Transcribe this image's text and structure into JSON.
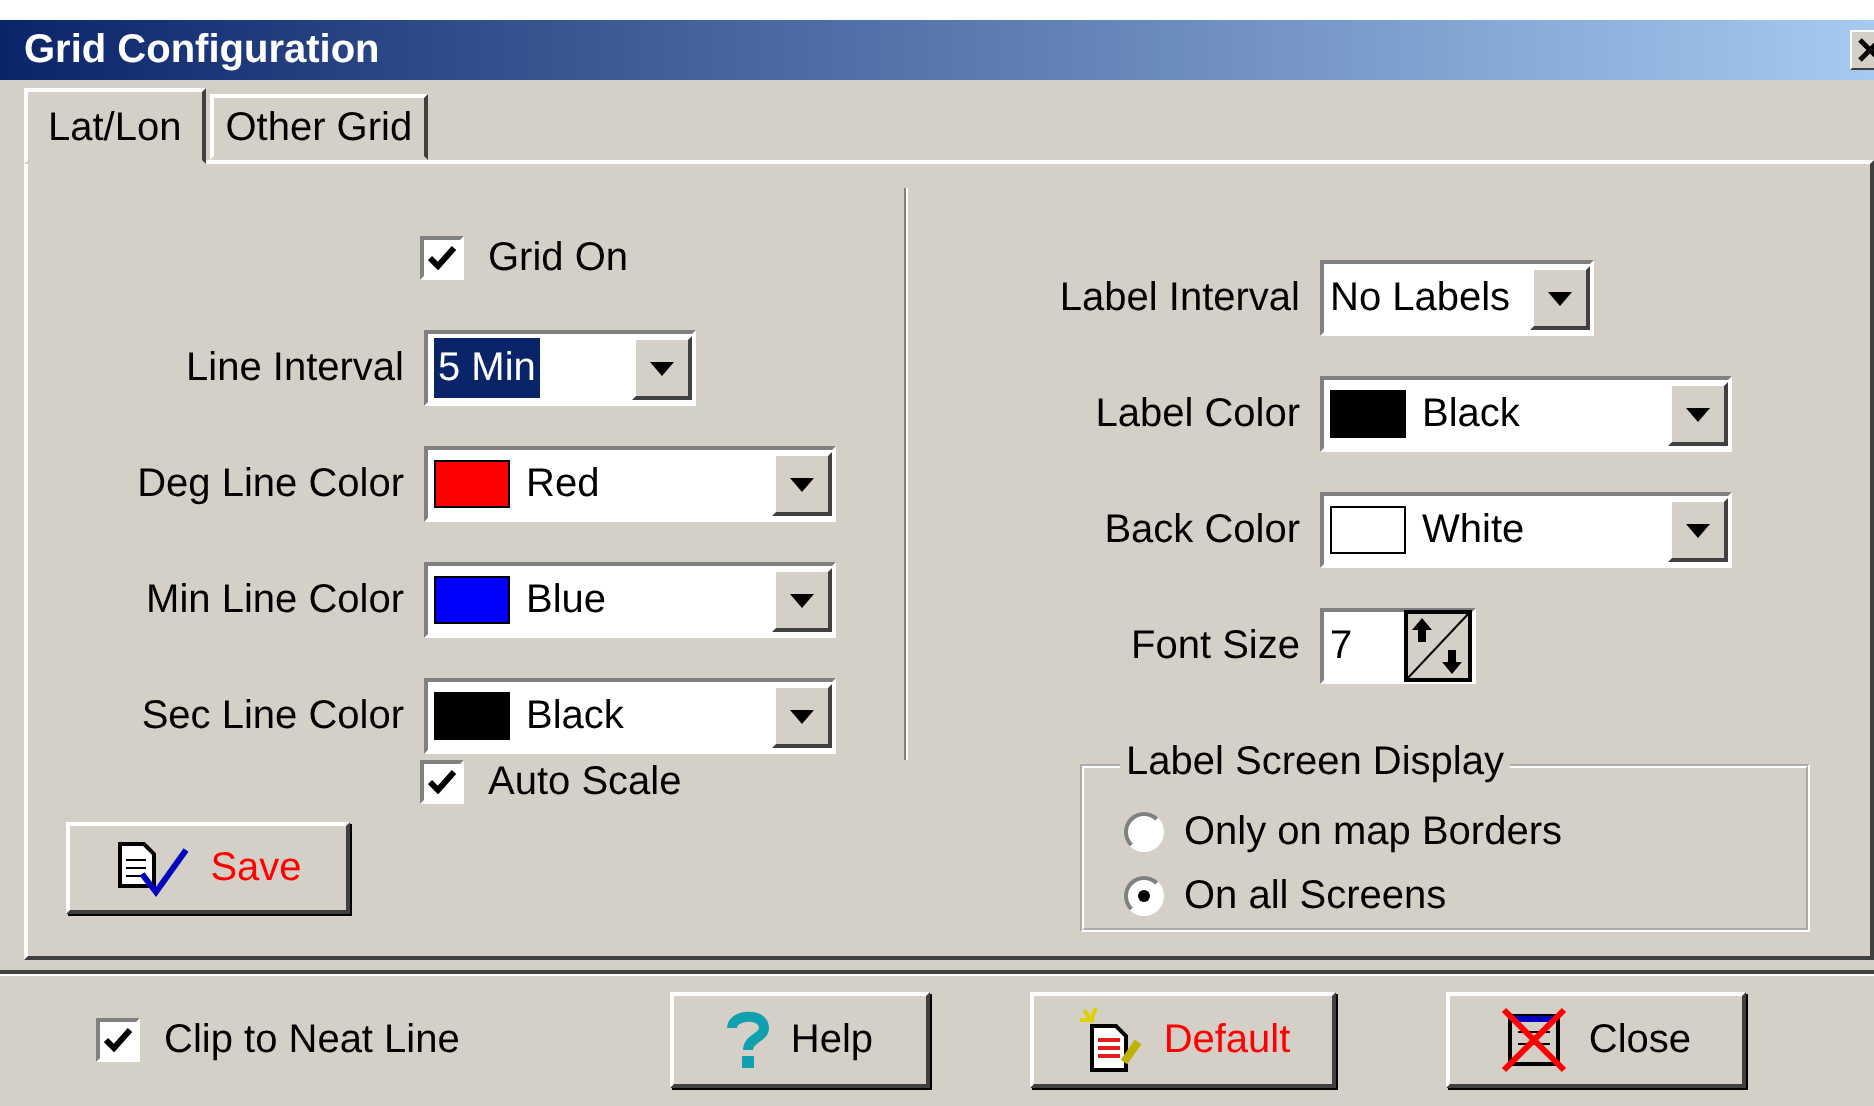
{
  "window": {
    "title": "Grid Configuration"
  },
  "tabs": [
    {
      "label": "Lat/Lon",
      "selected": true
    },
    {
      "label": "Other Grid",
      "selected": false
    }
  ],
  "grid_on": {
    "label": "Grid On",
    "checked": true
  },
  "left_fields": [
    {
      "label": "Line Interval",
      "value": "5 Min",
      "kind": "select",
      "highlighted": true
    },
    {
      "label": "Deg Line Color",
      "value": "Red",
      "kind": "color",
      "color": "#ff0000"
    },
    {
      "label": "Min Line Color",
      "value": "Blue",
      "kind": "color",
      "color": "#0000ff"
    },
    {
      "label": "Sec Line Color",
      "value": "Black",
      "kind": "color",
      "color": "#000000"
    }
  ],
  "auto_scale": {
    "label": "Auto Scale",
    "checked": true
  },
  "save_button": {
    "label": "Save"
  },
  "right_fields": [
    {
      "label": "Label Interval",
      "value": "No Labels",
      "kind": "select",
      "highlighted": false
    },
    {
      "label": "Label Color",
      "value": "Black",
      "kind": "color",
      "color": "#000000"
    },
    {
      "label": "Back Color",
      "value": "White",
      "kind": "color",
      "color": "#ffffff"
    },
    {
      "label": "Font Size",
      "value": "7",
      "kind": "spin"
    }
  ],
  "label_screen_display": {
    "title": "Label Screen Display",
    "options": [
      {
        "label": "Only on map Borders",
        "selected": false
      },
      {
        "label": "On all Screens",
        "selected": true
      }
    ]
  },
  "clip_to_neat_line": {
    "label": "Clip to Neat Line",
    "checked": true
  },
  "buttons": [
    {
      "label": "Help",
      "kind": "help"
    },
    {
      "label": "Default",
      "kind": "default"
    },
    {
      "label": "Close",
      "kind": "close"
    }
  ]
}
